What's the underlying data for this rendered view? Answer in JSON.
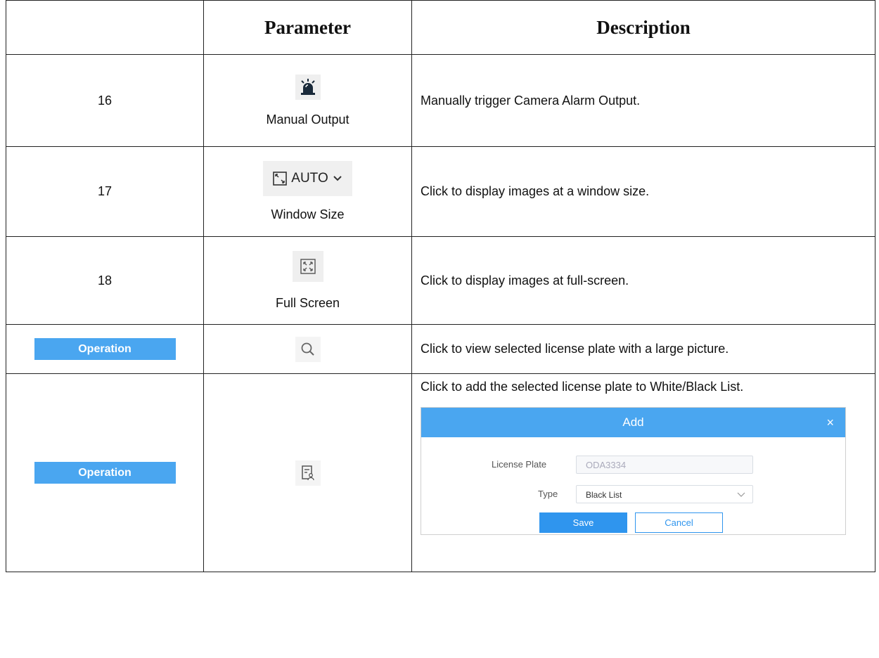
{
  "header": {
    "col1": "",
    "col2": "Parameter",
    "col3": "Description"
  },
  "rows": [
    {
      "num": "16",
      "param_label": "Manual Output",
      "icon": "alarm-siren-icon",
      "description": "Manually trigger Camera Alarm Output."
    },
    {
      "num": "17",
      "param_label": "Window Size",
      "icon": "window-size-icon",
      "control_text": "AUTO",
      "description": "Click to display images at a window size."
    },
    {
      "num": "18",
      "param_label": "Full Screen",
      "icon": "fullscreen-icon",
      "description": "Click to display images at full-screen."
    },
    {
      "num_button": "Operation",
      "icon": "search-icon",
      "description": "Click to view selected license plate with a large picture."
    },
    {
      "num_button": "Operation",
      "icon": "add-to-list-icon",
      "description": "Click to add the selected license plate to White/Black List."
    }
  ],
  "dialog": {
    "title": "Add",
    "close": "×",
    "license_plate_label": "License Plate",
    "license_plate_value": "ODA3334",
    "type_label": "Type",
    "type_value": "Black List",
    "save": "Save",
    "cancel": "Cancel"
  },
  "colors": {
    "accent": "#4aa6f0",
    "button": "#2f95ee"
  }
}
